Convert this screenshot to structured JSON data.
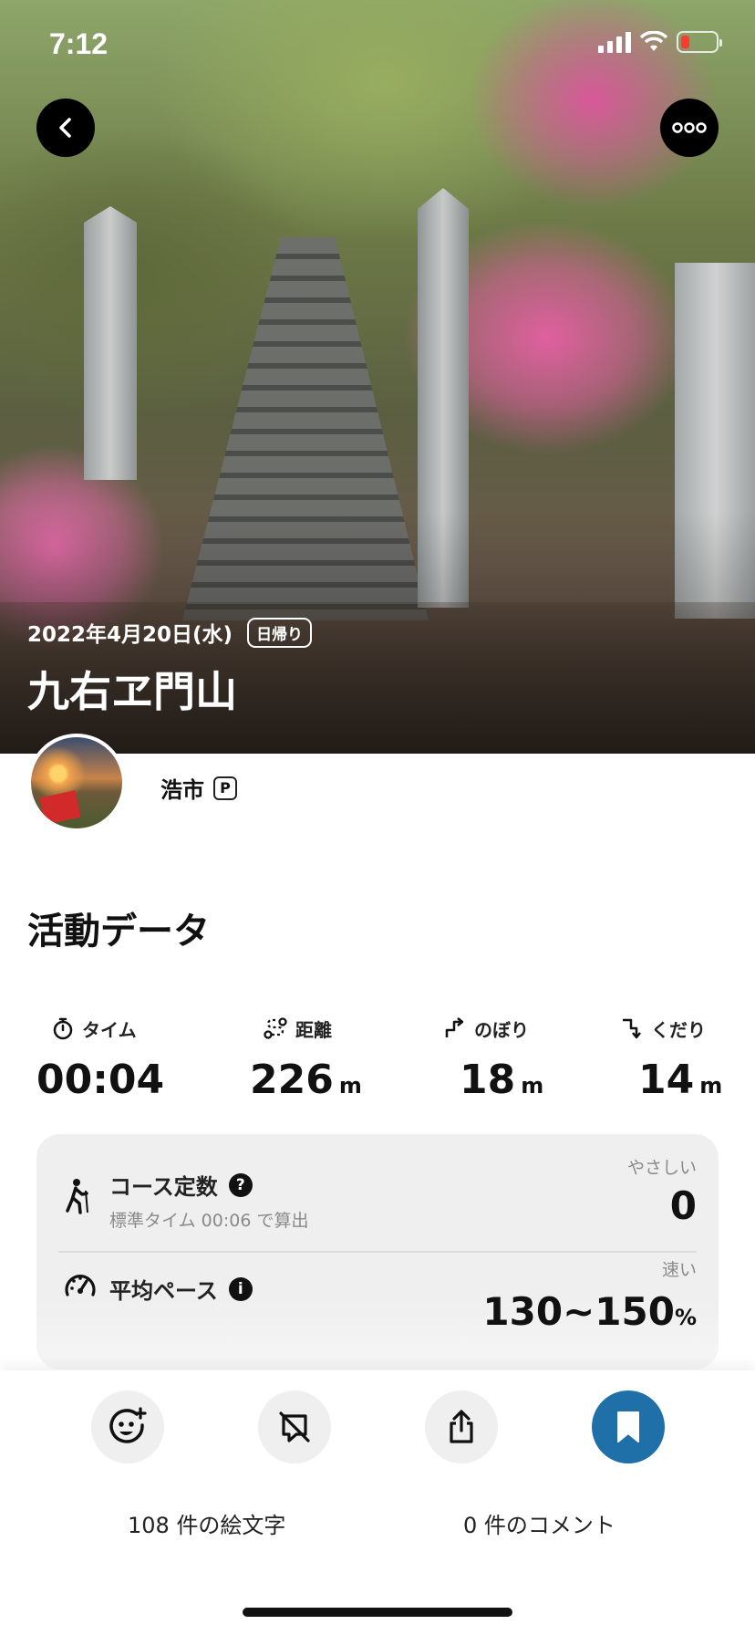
{
  "status_bar": {
    "time": "7:12"
  },
  "hero": {
    "date": "2022年4月20日(水)",
    "badge": "日帰り",
    "title": "九右ヱ門山"
  },
  "user": {
    "name": "浩市",
    "badge": "P"
  },
  "activity": {
    "section_title": "活動データ",
    "stats": [
      {
        "label": "タイム",
        "value": "00:04",
        "unit": "",
        "icon": "stopwatch-icon"
      },
      {
        "label": "距離",
        "value": "226",
        "unit": "m",
        "icon": "route-icon"
      },
      {
        "label": "のぼり",
        "value": "18",
        "unit": "m",
        "icon": "ascent-icon"
      },
      {
        "label": "くだり",
        "value": "14",
        "unit": "m",
        "icon": "descent-icon"
      }
    ],
    "course_constant": {
      "title": "コース定数",
      "help": "?",
      "sub": "標準タイム 00:06 で算出",
      "tag": "やさしい",
      "value": "0"
    },
    "avg_pace": {
      "title": "平均ペース",
      "info": "i",
      "tag": "速い",
      "value": "130~150",
      "unit": "%"
    }
  },
  "bottom": {
    "emoji_count_text": "108 件の絵文字",
    "comment_count_text": "0 件のコメント"
  },
  "colors": {
    "primary_action": "#1f6fa8",
    "battery_low": "#ff3b30"
  }
}
